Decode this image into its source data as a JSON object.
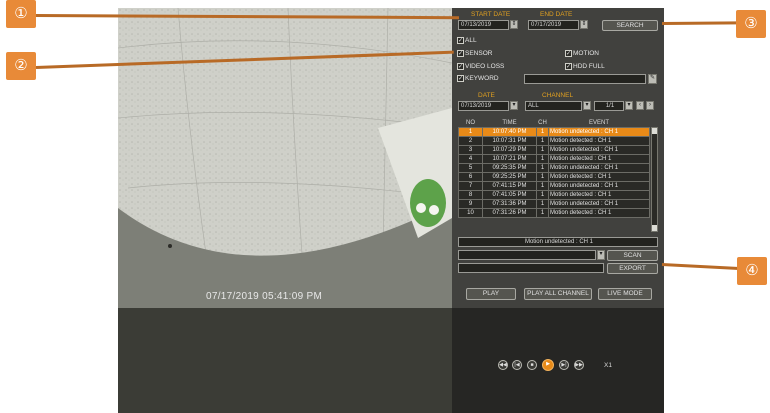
{
  "feed": {
    "timestamp": "07/17/2019 05:41:09 PM"
  },
  "search": {
    "start_label": "START DATE",
    "end_label": "END DATE",
    "start_value": "07/13/2019",
    "end_value": "07/17/2019",
    "search_button": "SEARCH"
  },
  "filters": {
    "all": "ALL",
    "sensor": "SENSOR",
    "motion": "MOTION",
    "video_loss": "VIDEO LOSS",
    "hdd_full": "HDD FULL",
    "keyword": "KEYWORD"
  },
  "selectors": {
    "date_label": "DATE",
    "channel_label": "CHANNEL",
    "date_value": "07/13/2019",
    "channel_value": "ALL",
    "page_value": "1/1"
  },
  "table": {
    "headers": [
      "NO",
      "TIME",
      "CH",
      "EVENT"
    ],
    "rows": [
      [
        "1",
        "10:07:40 PM",
        "1",
        "Motion undetected : CH 1"
      ],
      [
        "2",
        "10:07:31 PM",
        "1",
        "Motion detected : CH 1"
      ],
      [
        "3",
        "10:07:29 PM",
        "1",
        "Motion undetected : CH 1"
      ],
      [
        "4",
        "10:07:21 PM",
        "1",
        "Motion detected : CH 1"
      ],
      [
        "5",
        "09:25:35 PM",
        "1",
        "Motion undetected : CH 1"
      ],
      [
        "6",
        "09:25:25 PM",
        "1",
        "Motion detected : CH 1"
      ],
      [
        "7",
        "07:41:15 PM",
        "1",
        "Motion undetected : CH 1"
      ],
      [
        "8",
        "07:41:05 PM",
        "1",
        "Motion detected : CH 1"
      ],
      [
        "9",
        "07:31:36 PM",
        "1",
        "Motion undetected : CH 1"
      ],
      [
        "10",
        "07:31:26 PM",
        "1",
        "Motion detected : CH 1"
      ]
    ]
  },
  "detail": {
    "selected_event": "Motion undetected : CH 1"
  },
  "actions": {
    "scan": "SCAN",
    "export": "EXPORT",
    "play": "PLAY",
    "play_all": "PLAY ALL CHANNEL",
    "live_mode": "LIVE MODE"
  },
  "playback": {
    "speed": "X1"
  },
  "callouts": [
    "①",
    "②",
    "③",
    "④"
  ],
  "colors": {
    "accent": "#e88a18",
    "callout": "#e88a38",
    "panel": "#41413e"
  }
}
